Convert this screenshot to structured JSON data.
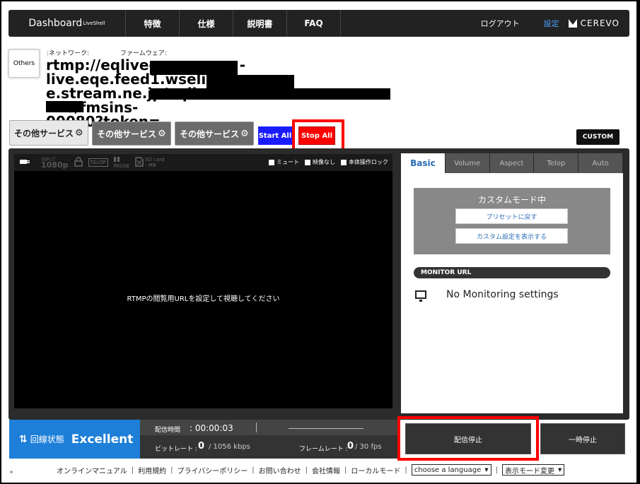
{
  "nav": {
    "brand": "Dashboard",
    "brand_sup": "LiveShell",
    "items": [
      "特徴",
      "仕様",
      "説明書",
      "FAQ"
    ],
    "logout": "ログアウト",
    "settings": "設定",
    "logo": "CEREVO"
  },
  "header": {
    "others_label": "Others",
    "network_label": ":ネットワーク:",
    "firmware_label": "ファームウェア:",
    "url_line1": "rtmp://eqlive-",
    "url_line1b": "-live.eqe.feed1.wseliv",
    "url_line2": "e.stream.ne.jp/eqlive-",
    "url_line2b": "-live/fmsins-",
    "url_line3": "00080?token="
  },
  "services": {
    "tabs": [
      "その他サービス",
      "その他サービス",
      "その他サービス"
    ],
    "gear_glyph": "⚙",
    "start_all": "Start All",
    "stop_all": "Stop All",
    "custom": "CUSTOM"
  },
  "status_strip": {
    "input_label": "INPUT",
    "resolution": "1080p",
    "telop": "TELOP",
    "pause": "PAUSE",
    "sd_label": "SD card",
    "sd_value": "- MB",
    "mute": "ミュート",
    "no_video": "映像なし",
    "lock": "本体操作ロック"
  },
  "video": {
    "message": "RTMPの閲覧用URLを設定して視聴してください"
  },
  "right_panel": {
    "tabs": [
      "Basic",
      "Volume",
      "Aspect",
      "Telop",
      "Auto"
    ],
    "custom_mode": "カスタムモード中",
    "reset_preset": "プリセットに戻す",
    "show_custom": "カスタム設定を表示する",
    "monitor_header": "MONITOR URL",
    "monitor_text": "No Monitoring settings"
  },
  "bottom": {
    "line_label": "回線状態",
    "line_value": "Excellent",
    "time_label": "配信時間",
    "time_value": ": 00:00:03",
    "bitrate_label": "ビットレート :",
    "bitrate_value": "0",
    "bitrate_unit": "/ 1056 kbps",
    "framerate_label": "フレームレート :",
    "framerate_value": "0",
    "framerate_unit": "/ 30 fps",
    "stop_stream": "配信停止",
    "pause": "一時停止"
  },
  "footer": {
    "links": [
      "オンラインマニュアル",
      "利用規約",
      "プライバシーポリシー",
      "お問い合わせ",
      "会社情報",
      "ローカルモード"
    ],
    "language": "choose a language",
    "display_mode": "表示モード変更"
  }
}
